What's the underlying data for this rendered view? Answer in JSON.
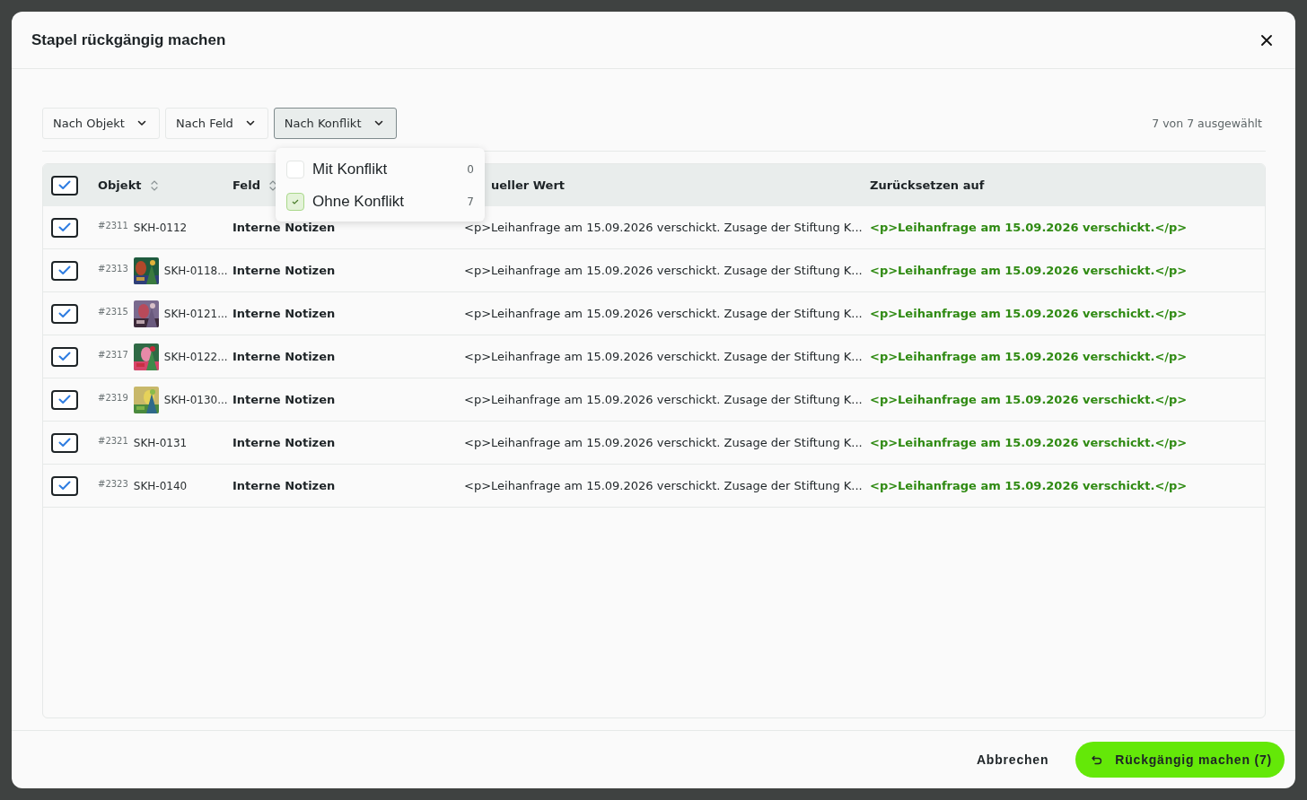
{
  "dialog": {
    "title": "Stapel rückgängig machen"
  },
  "filters": [
    {
      "label": "Nach Objekt",
      "open": false
    },
    {
      "label": "Nach Feld",
      "open": false
    },
    {
      "label": "Nach Konflikt",
      "open": true
    }
  ],
  "selection_count": "7 von 7 ausgewählt",
  "conflict_menu": [
    {
      "label": "Mit Konflikt",
      "count": "0",
      "checked": false
    },
    {
      "label": "Ohne Konflikt",
      "count": "7",
      "checked": true
    }
  ],
  "table": {
    "all_checked": true,
    "columns": [
      "Objekt",
      "Feld",
      "ueller Wert",
      "Zurücksetzen auf"
    ],
    "rows": [
      {
        "checked": true,
        "id": "#2311",
        "kind": "plain",
        "object": "SKH-0112",
        "field": "Interne Notizen",
        "current": "<p>Leihanfrage am 15.09.2026 verschickt. Zusage der Stiftung K...",
        "reset": "<p>Leihanfrage am 15.09.2026 verschickt.</p>"
      },
      {
        "checked": true,
        "id": "#2313",
        "kind": "thumbnail",
        "object": "SKH-0118...",
        "field": "Interne Notizen",
        "current": "<p>Leihanfrage am 15.09.2026 verschickt. Zusage der Stiftung K...",
        "reset": "<p>Leihanfrage am 15.09.2026 verschickt.</p>"
      },
      {
        "checked": true,
        "id": "#2315",
        "kind": "thumbnail",
        "object": "SKH-0121...",
        "field": "Interne Notizen",
        "current": "<p>Leihanfrage am 15.09.2026 verschickt. Zusage der Stiftung K...",
        "reset": "<p>Leihanfrage am 15.09.2026 verschickt.</p>"
      },
      {
        "checked": true,
        "id": "#2317",
        "kind": "thumbnail",
        "object": "SKH-0122...",
        "field": "Interne Notizen",
        "current": "<p>Leihanfrage am 15.09.2026 verschickt. Zusage der Stiftung K...",
        "reset": "<p>Leihanfrage am 15.09.2026 verschickt.</p>"
      },
      {
        "checked": true,
        "id": "#2319",
        "kind": "thumbnail",
        "object": "SKH-0130...",
        "field": "Interne Notizen",
        "current": "<p>Leihanfrage am 15.09.2026 verschickt. Zusage der Stiftung K...",
        "reset": "<p>Leihanfrage am 15.09.2026 verschickt.</p>"
      },
      {
        "checked": true,
        "id": "#2321",
        "kind": "plain",
        "object": "SKH-0131",
        "field": "Interne Notizen",
        "current": "<p>Leihanfrage am 15.09.2026 verschickt. Zusage der Stiftung K...",
        "reset": "<p>Leihanfrage am 15.09.2026 verschickt.</p>"
      },
      {
        "checked": true,
        "id": "#2323",
        "kind": "plain",
        "object": "SKH-0140",
        "field": "Interne Notizen",
        "current": "<p>Leihanfrage am 15.09.2026 verschickt. Zusage der Stiftung K...",
        "reset": "<p>Leihanfrage am 15.09.2026 verschickt.</p>"
      }
    ]
  },
  "footer": {
    "cancel": "Abbrechen",
    "confirm": "Rückgängig machen (7)"
  }
}
